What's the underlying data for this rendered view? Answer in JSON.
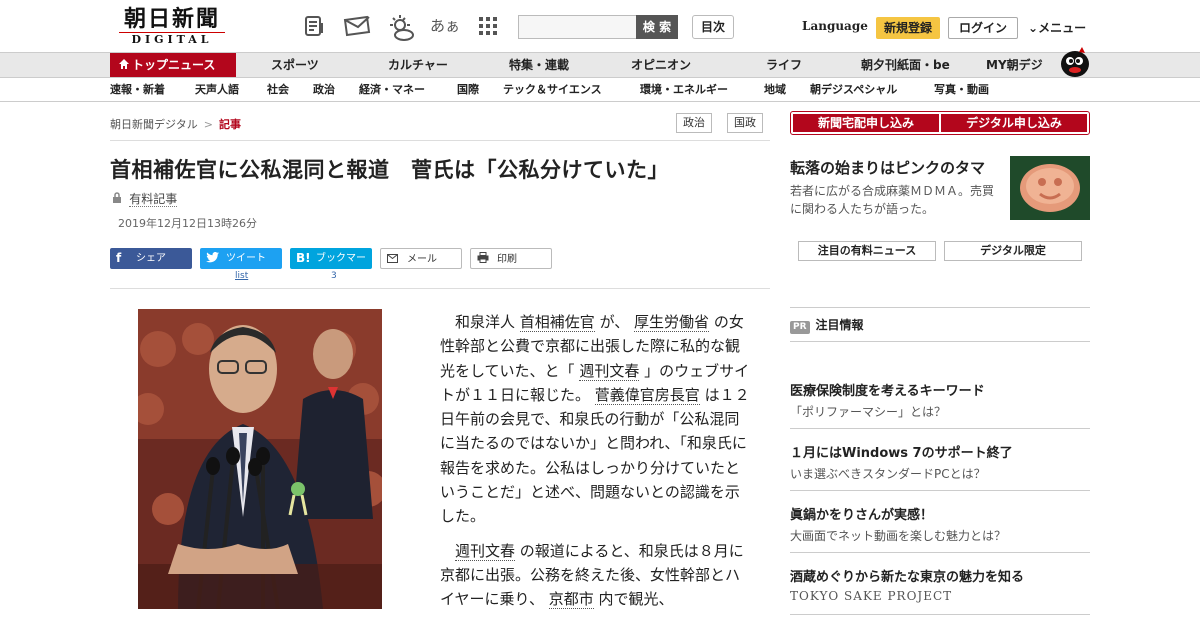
{
  "header": {
    "logo_top": "朝日新聞",
    "logo_bottom": "DIGITAL",
    "icons": [
      "newspaper-icon",
      "mail-icon",
      "weather-icon",
      "font-size-icon",
      "grid-menu-icon"
    ],
    "font_size_glyph": "あぁ",
    "search_placeholder": "",
    "search_button": "検 索",
    "index_button": "目次",
    "language": "Language",
    "register": "新規登録",
    "login": "ログイン",
    "menu": "メニュー"
  },
  "nav_main": [
    "トップニュース",
    "スポーツ",
    "カルチャー",
    "特集・連載",
    "オピニオン",
    "ライフ",
    "朝夕刊紙面・be",
    "MY朝デジ"
  ],
  "nav_sub": [
    "速報・新着",
    "天声人語",
    "社会",
    "政治",
    "経済・マネー",
    "国際",
    "テック＆サイエンス",
    "環境・エネルギー",
    "地域",
    "朝デジスペシャル",
    "写真・動画"
  ],
  "breadcrumb": {
    "home": "朝日新聞デジタル",
    "separator": ">",
    "current": "記事"
  },
  "tags": [
    "政治",
    "国政"
  ],
  "article": {
    "headline": "首相補佐官に公私混同と報道　菅氏は「公私分けていた」",
    "paid_label": "有料記事",
    "date": "2019年12月12日13時26分",
    "share": {
      "facebook": "シェア",
      "twitter": "ツイート",
      "hatena": "ブックマーク",
      "mail": "メール",
      "print": "印刷",
      "twitter_count": "list",
      "hatena_count": "3"
    },
    "p1": {
      "t1": "和泉洋人 ",
      "l1": "首相補佐官",
      "t2": " が、 ",
      "l2": "厚生労働省",
      "t3": " の女性幹部と公費で京都に出張した際に私的な観光をしていた、と「 ",
      "l3": "週刊文春",
      "t4": " 」のウェブサイトが１１日に報じた。 ",
      "l4": "菅義偉官房長官",
      "t5": " は１２日午前の会見で、和泉氏の行動が「公私混同に当たるのではないか」と問われ、「和泉氏に報告を求めた。公私はしっかり分けていたということだ」と述べ、問題ないとの認識を示した。"
    },
    "p2": {
      "l1": "週刊文春",
      "t1": " の報道によると、和泉氏は８月に京都に出張。公務を終えた後、女性幹部とハイヤーに乗り、 ",
      "l2": "京都市",
      "t2": " 内で観光、"
    }
  },
  "sidebar": {
    "subscribe_paper": "新聞宅配申し込み",
    "subscribe_digital": "デジタル申し込み",
    "promo_title": "転落の始まりはピンクのタマ",
    "promo_desc": "若者に広がる合成麻薬ＭＤＭＡ。売買に関わる人たちが語った。",
    "pill_paid_news": "注目の有料ニュース",
    "pill_digital_only": "デジタル限定",
    "pr_badge": "PR",
    "pr_title": "注目情報",
    "ads": [
      {
        "title": "医療保険制度を考えるキーワード",
        "sub": "「ポリファーマシー」とは？"
      },
      {
        "title": "１月にはWindows 7のサポート終了",
        "sub": "いま選ぶべきスタンダードPCとは？"
      },
      {
        "title": "眞鍋かをりさんが実感！",
        "sub": "大画面でネット動画を楽しむ魅力とは？"
      },
      {
        "title": "酒蔵めぐりから新たな東京の魅力を知る",
        "sub": "TOKYO SAKE PROJECT"
      }
    ]
  },
  "colors": {
    "brand_red": "#b3061c",
    "register_yellow": "#f5c542",
    "facebook": "#3b5998",
    "twitter": "#1da1f2",
    "hatena": "#00a4de"
  }
}
